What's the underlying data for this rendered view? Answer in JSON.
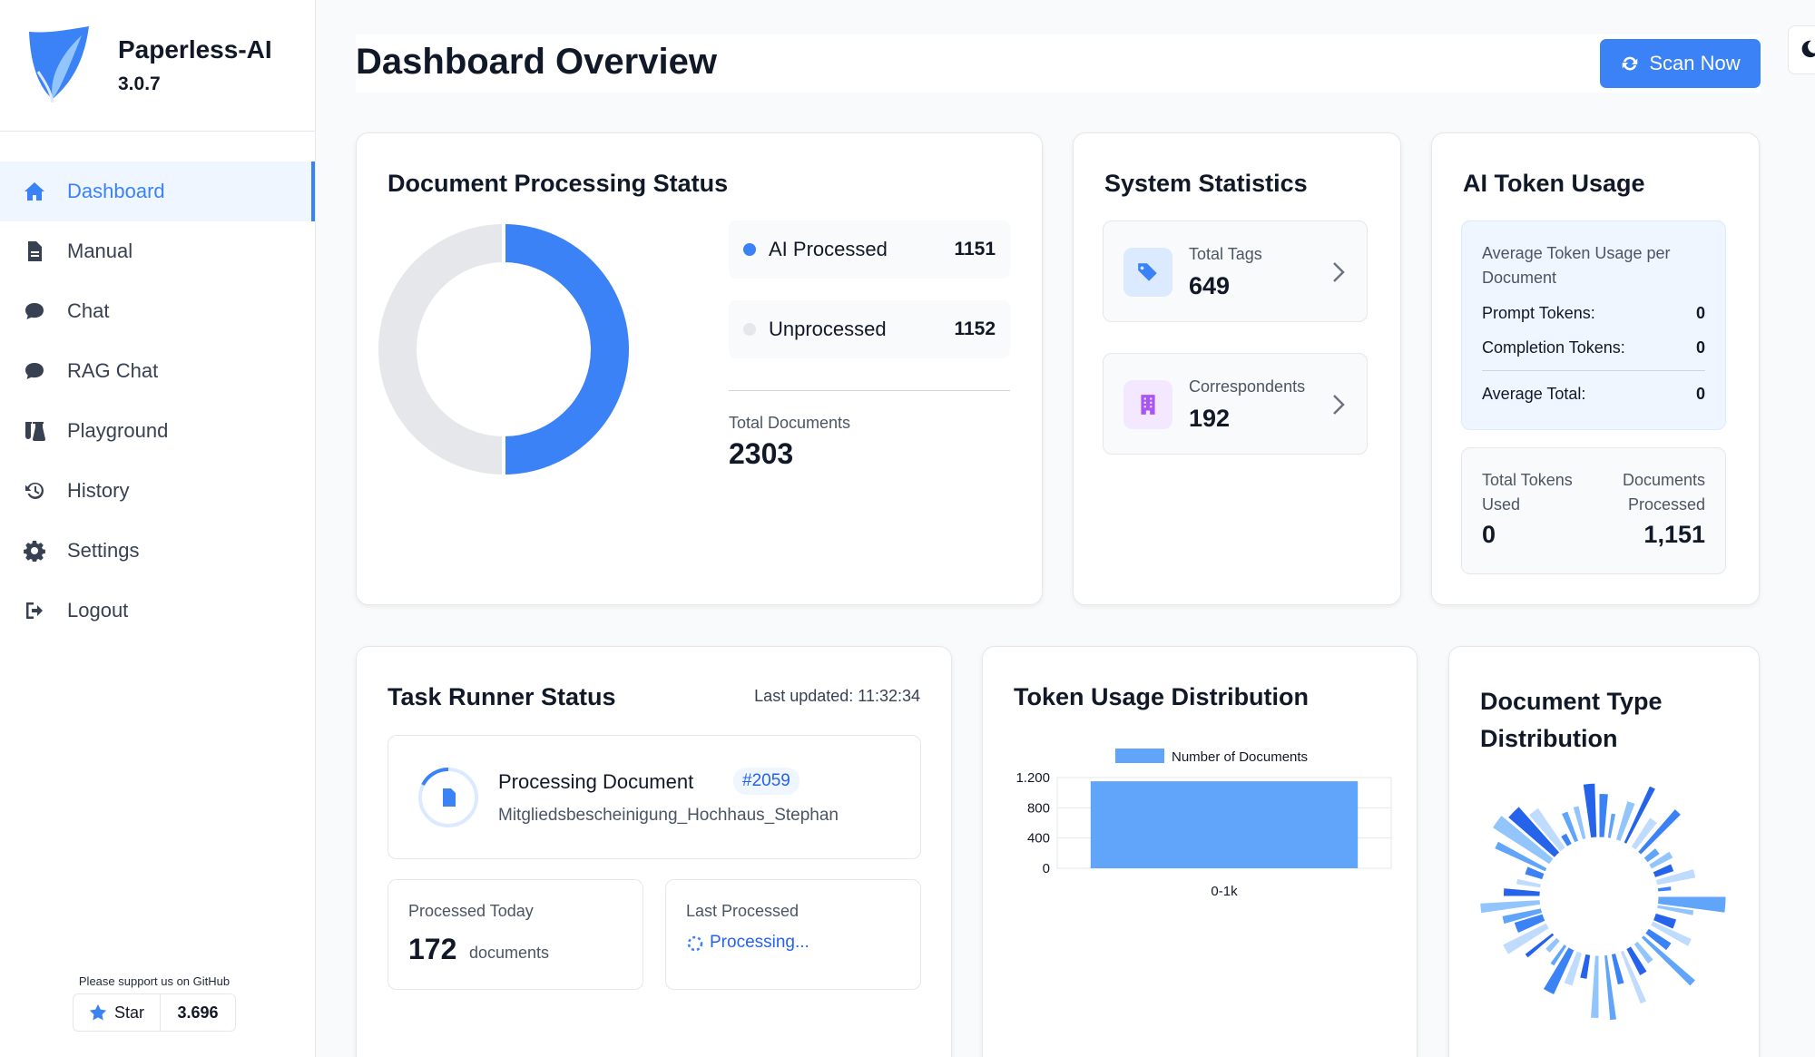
{
  "app": {
    "name": "Paperless-AI",
    "version": "3.0.7"
  },
  "sidebar": {
    "items": [
      {
        "label": "Dashboard",
        "icon": "home-icon",
        "active": true
      },
      {
        "label": "Manual",
        "icon": "file-icon"
      },
      {
        "label": "Chat",
        "icon": "chat-icon"
      },
      {
        "label": "RAG Chat",
        "icon": "chat-icon"
      },
      {
        "label": "Playground",
        "icon": "flask-icon"
      },
      {
        "label": "History",
        "icon": "history-icon"
      },
      {
        "label": "Settings",
        "icon": "gear-icon"
      },
      {
        "label": "Logout",
        "icon": "logout-icon"
      }
    ],
    "github": {
      "support_text": "Please support us on GitHub",
      "star_label": "Star",
      "star_count": "3.696"
    }
  },
  "header": {
    "title": "Dashboard Overview",
    "scan_label": "Scan Now"
  },
  "processing": {
    "title": "Document Processing Status",
    "ai_label": "AI Processed",
    "ai_value": "1151",
    "unprocessed_label": "Unprocessed",
    "unprocessed_value": "1152",
    "total_label": "Total Documents",
    "total_value": "2303",
    "colors": {
      "ai": "#3b82f6",
      "unprocessed": "#e5e7eb"
    }
  },
  "system": {
    "title": "System Statistics",
    "tags_label": "Total Tags",
    "tags_value": "649",
    "corr_label": "Correspondents",
    "corr_value": "192"
  },
  "token": {
    "title": "AI Token Usage",
    "avg_heading": "Average Token Usage per Document",
    "prompt_label": "Prompt Tokens:",
    "prompt_value": "0",
    "completion_label": "Completion Tokens:",
    "completion_value": "0",
    "avg_total_label": "Average Total:",
    "avg_total_value": "0",
    "total_used_label": "Total Tokens Used",
    "total_used_value": "0",
    "docs_processed_label": "Documents Processed",
    "docs_processed_value": "1,151"
  },
  "task_runner": {
    "title": "Task Runner Status",
    "last_updated": "Last updated: 11:32:34",
    "processing_label": "Processing Document",
    "doc_id": "#2059",
    "doc_name": "Mitgliedsbescheinigung_Hochhaus_Stephan",
    "today_label": "Processed Today",
    "today_value": "172",
    "today_unit": "documents",
    "last_label": "Last Processed",
    "last_value": "Processing..."
  },
  "token_distribution": {
    "title": "Token Usage Distribution"
  },
  "doc_type": {
    "title": "Document Type Distribution"
  },
  "chart_data": {
    "type": "bar",
    "categories": [
      "0-1k"
    ],
    "series": [
      {
        "name": "Number of Documents",
        "values": [
          1151
        ]
      }
    ],
    "yticks": [
      "0",
      "400",
      "800",
      "1.200"
    ],
    "ylim": [
      0,
      1200
    ],
    "color": "#60a5fa",
    "legend": "top"
  }
}
